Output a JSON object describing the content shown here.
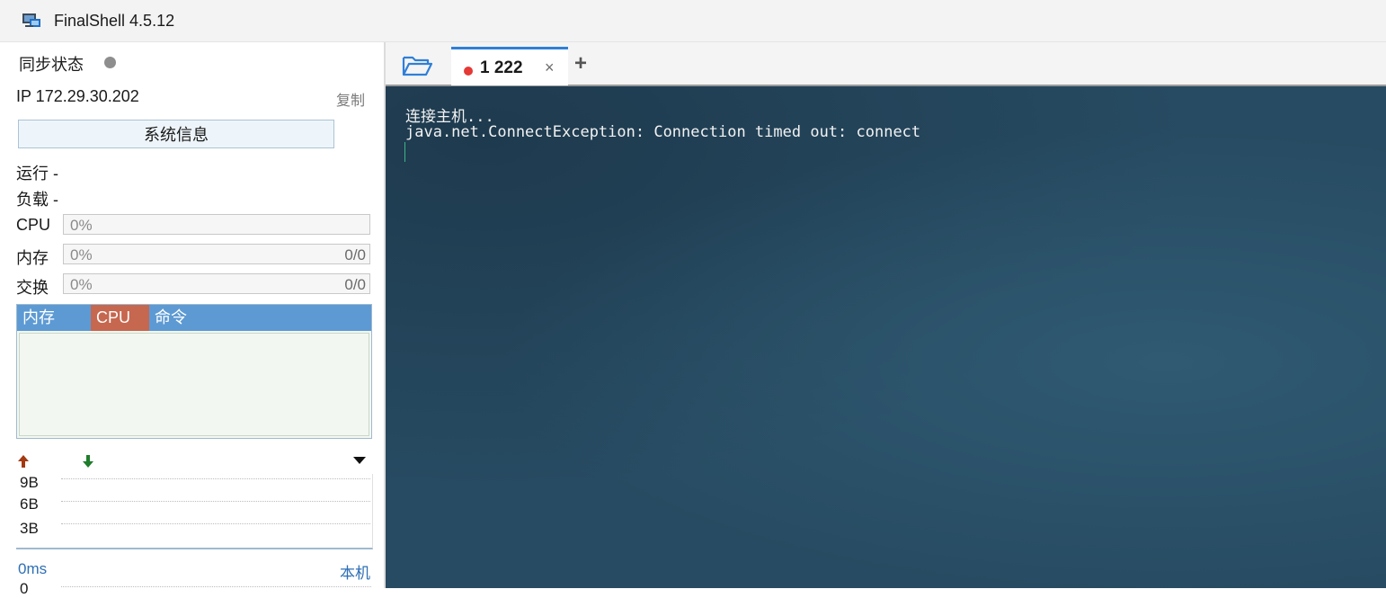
{
  "window": {
    "title": "FinalShell 4.5.12",
    "icon": "finalshell-app-icon"
  },
  "sidebar": {
    "sync_label": "同步状态",
    "sync_status_color": "#8e8e8e",
    "ip_label": "IP  172.29.30.202",
    "copy_label": "复制",
    "sysinfo_label": "系统信息",
    "run_label": "运行 -",
    "load_label": "负载 -",
    "meters": [
      {
        "label": "CPU",
        "percent": "0%",
        "ratio": ""
      },
      {
        "label": "内存",
        "percent": "0%",
        "ratio": "0/0"
      },
      {
        "label": "交换",
        "percent": "0%",
        "ratio": "0/0"
      }
    ],
    "process_table": {
      "columns": [
        "内存",
        "CPU",
        "命令"
      ],
      "header_color": "#5d9ad3",
      "active_sort_color": "#c6674f"
    },
    "network": {
      "upload_icon": "arrow-up-icon",
      "download_icon": "arrow-down-icon",
      "upload_color": "#a33a12",
      "download_color": "#1e7d2a",
      "ticks": [
        "9B",
        "6B",
        "3B"
      ]
    },
    "ping": {
      "latency": "0ms",
      "target": "本机",
      "tick": "0"
    }
  },
  "tabs": {
    "items": [
      {
        "label": "1 222",
        "status_color": "#e53935",
        "active": true
      }
    ],
    "add_label": "+",
    "close_label": "×",
    "active_accent": "#2f7fd8"
  },
  "terminal": {
    "lines": [
      "连接主机...",
      "java.net.ConnectException: Connection timed out: connect"
    ]
  }
}
